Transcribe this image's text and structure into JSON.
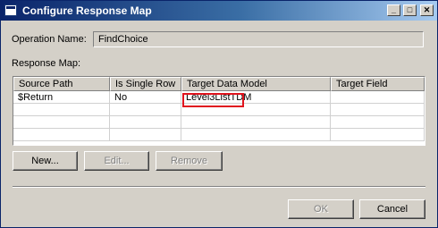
{
  "window": {
    "title": "Configure Response Map",
    "minimize_glyph": "_",
    "maximize_glyph": "□",
    "close_glyph": "✕"
  },
  "operation": {
    "label": "Operation Name:",
    "value": "FindChoice"
  },
  "response_map": {
    "label": "Response Map:",
    "columns": [
      "Source Path",
      "Is Single Row",
      "Target Data Model",
      "Target Field"
    ],
    "rows": [
      [
        "$Return",
        "No",
        "Level3ListTDM",
        ""
      ]
    ]
  },
  "buttons": {
    "new": "New...",
    "edit": "Edit...",
    "remove": "Remove",
    "ok": "OK",
    "cancel": "Cancel"
  },
  "colors": {
    "title_gradient_start": "#0a246a",
    "highlight": "#e0141e",
    "dialog_bg": "#d4d0c8"
  }
}
